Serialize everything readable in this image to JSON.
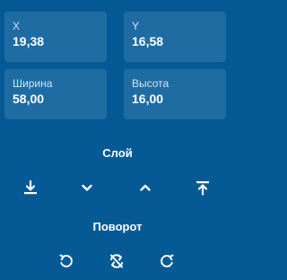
{
  "fields": {
    "x": {
      "label": "X",
      "value": "19,38"
    },
    "y": {
      "label": "Y",
      "value": "16,58"
    },
    "width": {
      "label": "Ширина",
      "value": "58,00"
    },
    "height": {
      "label": "Высота",
      "value": "16,00"
    }
  },
  "layer": {
    "title": "Слой",
    "buttons": [
      "send-to-back-icon",
      "send-backward-icon",
      "bring-forward-icon",
      "bring-to-front-icon"
    ]
  },
  "rotation": {
    "title": "Поворот",
    "buttons": [
      "rotate-left-icon",
      "flip-icon",
      "rotate-right-icon"
    ]
  },
  "colors": {
    "background": "#055a96",
    "field_background": "#1f6ca3",
    "text": "#ffffff"
  }
}
